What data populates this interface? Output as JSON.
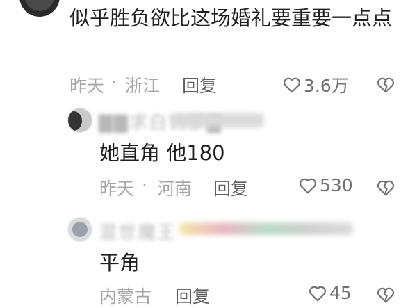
{
  "main_comment": {
    "text": "似乎胜负欲比这场婚礼要重要一点点",
    "time": "昨天",
    "separator": "·",
    "location": "浙江",
    "reply_label": "回复",
    "likes": "3.6万"
  },
  "replies": [
    {
      "username": "▇▇求白钓梦▇",
      "text": "她直角 他180",
      "time": "昨天",
      "separator": "·",
      "location": "河南",
      "reply_label": "回复",
      "likes": "530"
    },
    {
      "username": "混世魔王",
      "text": "平角",
      "location": "内蒙古",
      "reply_label": "回复",
      "likes": "45"
    }
  ],
  "icons": {
    "like": "heart-outline-icon",
    "dislike": "broken-heart-icon"
  },
  "colors": {
    "text": "#1f1f1f",
    "meta": "#a6a6a6",
    "reply": "#5f5f5f",
    "like": "#6f6f6f"
  }
}
